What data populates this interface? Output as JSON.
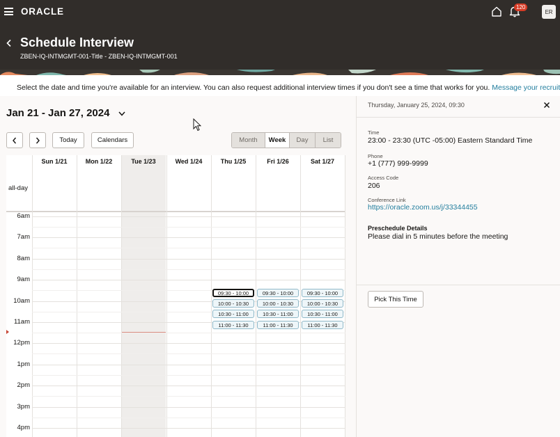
{
  "topbar": {
    "logo": "ORACLE",
    "notification_count": "120",
    "avatar_initials": "ER"
  },
  "header": {
    "title": "Schedule Interview",
    "subtitle": "ZBEN-IQ-INTMGMT-001-Title - ZBEN-IQ-INTMGMT-001"
  },
  "intro": {
    "text": "Select the date and time you're available for an interview. You can also request additional interview times if you don't see a time that works for you. ",
    "link": "Message your recruiter"
  },
  "calendar": {
    "range": "Jan 21 - Jan 27, 2024",
    "prev_label": "‹",
    "next_label": "›",
    "today_label": "Today",
    "calendars_label": "Calendars",
    "views": [
      "Month",
      "Week",
      "Day",
      "List"
    ],
    "active_view": "Week",
    "days": [
      "Sun 1/21",
      "Mon 1/22",
      "Tue 1/23",
      "Wed 1/24",
      "Thu 1/25",
      "Fri 1/26",
      "Sat 1/27"
    ],
    "allday_label": "all-day",
    "hours": [
      "6am",
      "7am",
      "8am",
      "9am",
      "10am",
      "11am",
      "12pm",
      "1pm",
      "2pm",
      "3pm",
      "4pm"
    ],
    "slot_days": [
      4,
      5,
      6
    ],
    "slots": [
      "09:30 - 10:00",
      "10:00 - 10:30",
      "10:30 - 11:00",
      "11:00 - 11:30"
    ],
    "selected_slot": {
      "day": 4,
      "slot": 0
    }
  },
  "details": {
    "date_time": "Thursday, January 25, 2024, 09:30",
    "time_label": "Time",
    "time_value": "23:00 - 23:30 (UTC -05:00)  Eastern Standard Time",
    "phone_label": "Phone",
    "phone_value": "+1 (777) 999-9999",
    "access_label": "Access Code",
    "access_value": "206",
    "conference_label": "Conference Link",
    "conference_value": "https://oracle.zoom.us/j/33344455",
    "preschedule_label": "Preschedule Details",
    "preschedule_value": "Please dial in 5 minutes before the meeting",
    "pick_label": "Pick This Time"
  }
}
